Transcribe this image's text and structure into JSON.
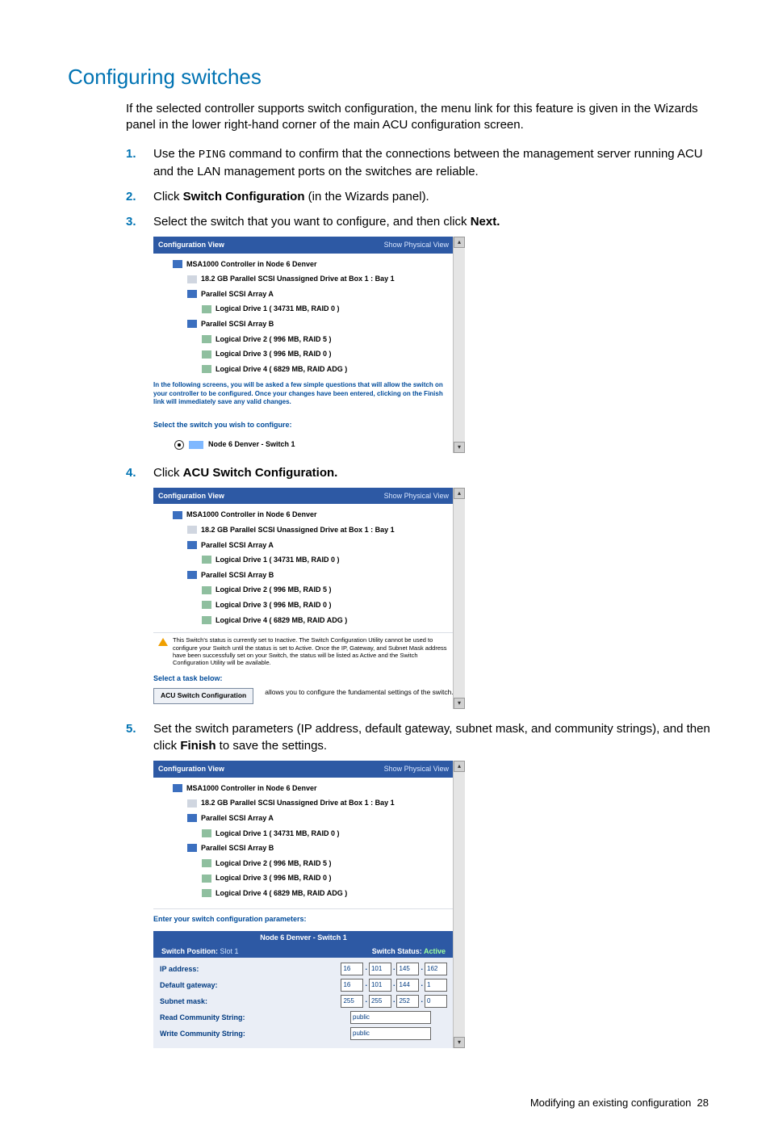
{
  "heading": "Configuring switches",
  "lead": "If the selected controller supports switch configuration, the menu link for this feature is given in the Wizards panel in the lower right-hand corner of the main ACU configuration screen.",
  "steps": {
    "s1": {
      "num": "1.",
      "pre": "Use the ",
      "code": "PING",
      "post": " command to confirm that the connections between the management server running ACU and the LAN management ports on the switches are reliable."
    },
    "s2": {
      "num": "2.",
      "pre": "Click ",
      "bold": "Switch Configuration",
      "post": " (in the Wizards panel)."
    },
    "s3": {
      "num": "3.",
      "text": "Select the switch that you want to configure, and then click ",
      "bold": "Next."
    },
    "s4": {
      "num": "4.",
      "pre": "Click ",
      "bold": "ACU Switch Configuration."
    },
    "s5": {
      "num": "5.",
      "text": "Set the switch parameters (IP address, default gateway, subnet mask, and community strings), and then click ",
      "bold": "Finish",
      "post": " to save the settings."
    }
  },
  "cv": {
    "title": "Configuration View",
    "phys": "Show Physical View",
    "tree": {
      "ctrl": "MSA1000 Controller in Node 6 Denver",
      "drv": "18.2 GB Parallel SCSI Unassigned Drive at Box 1 : Bay 1",
      "arrA": "Parallel SCSI Array A",
      "ld1": "Logical Drive 1 ( 34731 MB, RAID 0 )",
      "arrB": "Parallel SCSI Array B",
      "ld2": "Logical Drive 2 ( 996 MB, RAID 5 )",
      "ld3": "Logical Drive 3 ( 996 MB, RAID 0 )",
      "ld4": "Logical Drive 4 ( 6829 MB, RAID ADG )"
    }
  },
  "shot1": {
    "blurb": "In the following screens, you will be asked a few simple questions that will allow the switch on your controller to be configured. Once your changes have been entered, clicking on the Finish link will immediately save any valid changes.",
    "select": "Select the switch you wish to configure:",
    "radio": "Node 6 Denver - Switch 1"
  },
  "shot2": {
    "warn": "This Switch's status is currently set to Inactive. The Switch Configuration Utility cannot be used to configure your Switch until the status is set to Active. Once the IP, Gateway, and Subnet Mask address have been successfully set on your Switch, the status will be listed as Active and the Switch Configuration Utility will be available.",
    "task_lbl": "Select a task below:",
    "task_btn": "ACU Switch Configuration",
    "task_desc": "allows you to configure the fundamental settings of the switch."
  },
  "shot3": {
    "enter": "Enter your switch configuration parameters:",
    "form_head": "Node 6 Denver - Switch 1",
    "pos_lbl": "Switch Position:",
    "pos_val": "Slot 1",
    "state_lbl": "Switch Status:",
    "state_val": "Active",
    "rows": {
      "ip": {
        "label": "IP address:",
        "o": [
          "16",
          "101",
          "145",
          "162"
        ]
      },
      "gw": {
        "label": "Default gateway:",
        "o": [
          "16",
          "101",
          "144",
          "1"
        ]
      },
      "sm": {
        "label": "Subnet mask:",
        "o": [
          "255",
          "255",
          "252",
          "0"
        ]
      },
      "rc": {
        "label": "Read Community String:",
        "val": "public"
      },
      "wc": {
        "label": "Write Community String:",
        "val": "public"
      }
    }
  },
  "footer": {
    "text": "Modifying an existing configuration",
    "page": "28"
  }
}
